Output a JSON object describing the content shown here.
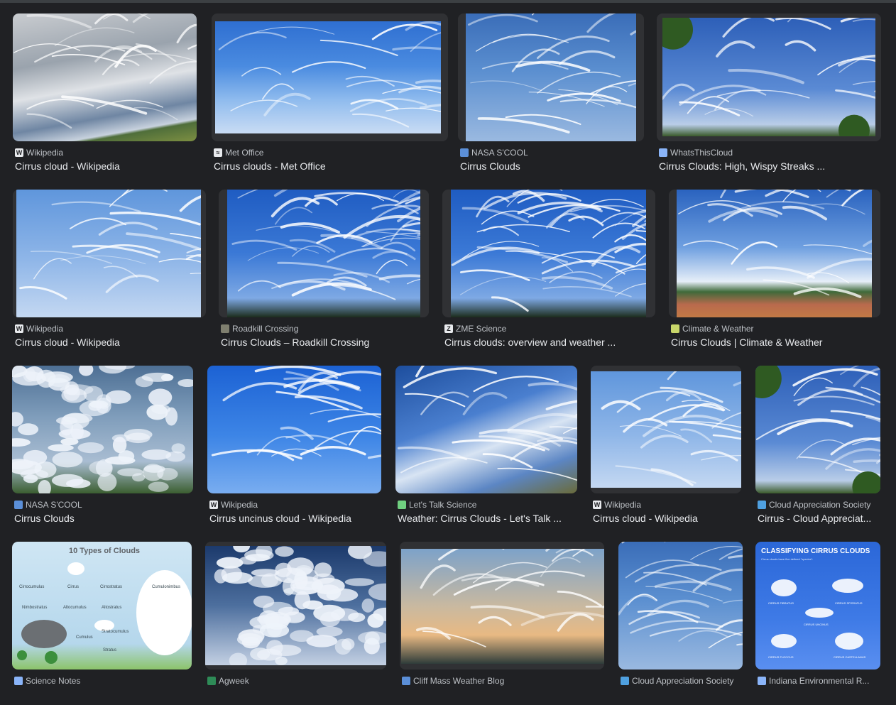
{
  "results": [
    {
      "source": "Wikipedia",
      "title": "Cirrus cloud - Wikipedia",
      "favicon": "wikipedia-icon",
      "fav_char": "W",
      "fav_color": "#e8eaed"
    },
    {
      "source": "Met Office",
      "title": "Cirrus clouds - Met Office",
      "favicon": "met-office-icon",
      "fav_char": "≈",
      "fav_color": "#e8eaed"
    },
    {
      "source": "NASA S'COOL",
      "title": "Cirrus Clouds",
      "favicon": "nasa-scool-icon",
      "fav_char": "",
      "fav_color": "#5b8fd8"
    },
    {
      "source": "WhatsThisCloud",
      "title": "Cirrus Clouds: High, Wispy Streaks ...",
      "favicon": "whatsthiscloud-icon",
      "fav_char": "",
      "fav_color": "#8ab4f8"
    },
    {
      "source": "Wikipedia",
      "title": "Cirrus cloud - Wikipedia",
      "favicon": "wikipedia-icon",
      "fav_char": "W",
      "fav_color": "#e8eaed"
    },
    {
      "source": "Roadkill Crossing",
      "title": "Cirrus Clouds – Roadkill Crossing",
      "favicon": "roadkill-crossing-icon",
      "fav_char": "",
      "fav_color": "#7f7f6f"
    },
    {
      "source": "ZME Science",
      "title": "Cirrus clouds: overview and weather ...",
      "favicon": "zme-science-icon",
      "fav_char": "Z",
      "fav_color": "#e8eaed"
    },
    {
      "source": "Climate & Weather",
      "title": "Cirrus Clouds | Climate & Weather",
      "favicon": "climate-weather-icon",
      "fav_char": "",
      "fav_color": "#c8d66a"
    },
    {
      "source": "NASA S'COOL",
      "title": "Cirrus Clouds",
      "favicon": "nasa-scool-icon",
      "fav_char": "",
      "fav_color": "#5b8fd8"
    },
    {
      "source": "Wikipedia",
      "title": "Cirrus uncinus cloud - Wikipedia",
      "favicon": "wikipedia-icon",
      "fav_char": "W",
      "fav_color": "#e8eaed"
    },
    {
      "source": "Let's Talk Science",
      "title": "Weather: Cirrus Clouds - Let's Talk ...",
      "favicon": "lets-talk-science-icon",
      "fav_char": "",
      "fav_color": "#6fcf7f"
    },
    {
      "source": "Wikipedia",
      "title": "Cirrus cloud - Wikipedia",
      "favicon": "wikipedia-icon",
      "fav_char": "W",
      "fav_color": "#e8eaed"
    },
    {
      "source": "Cloud Appreciation Society",
      "title": "Cirrus - Cloud Appreciat...",
      "favicon": "cloud-appreciation-society-icon",
      "fav_char": "",
      "fav_color": "#4fa0e0"
    },
    {
      "source": "Science Notes",
      "title": "",
      "favicon": "science-notes-icon",
      "fav_char": "",
      "fav_color": "#8ab4f8"
    },
    {
      "source": "Agweek",
      "title": "",
      "favicon": "agweek-icon",
      "fav_char": "",
      "fav_color": "#2e8b57"
    },
    {
      "source": "Cliff Mass Weather Blog",
      "title": "",
      "favicon": "cliff-mass-blog-icon",
      "fav_char": "",
      "fav_color": "#5b8fd8"
    },
    {
      "source": "Cloud Appreciation Society",
      "title": "",
      "favicon": "cloud-appreciation-society-icon",
      "fav_char": "",
      "fav_color": "#4fa0e0"
    },
    {
      "source": "Indiana Environmental R...",
      "title": "",
      "favicon": "indiana-environmental-icon",
      "fav_char": "",
      "fav_color": "#8ab4f8"
    }
  ],
  "infographic_types": {
    "title": "10 Types of Clouds",
    "labels": [
      "Cirrocumulus",
      "Cirrus",
      "Cirrostratus",
      "Cumulonimbus",
      "Nimbostratus",
      "Altocumulus",
      "Altostratus",
      "Stratocumulus",
      "Cumulus",
      "Stratus"
    ]
  },
  "infographic_classify": {
    "title": "CLASSIFYING CIRRUS CLOUDS",
    "subtitle": "Cirrus clouds have five defined \"species\":",
    "labels": [
      "CIRRUS FIBRATUS",
      "CIRRUS SPISSATUS",
      "CIRRUS UNCINUS",
      "CIRRUS FLOCCUS",
      "CIRRUS CASTELLANUS"
    ]
  }
}
